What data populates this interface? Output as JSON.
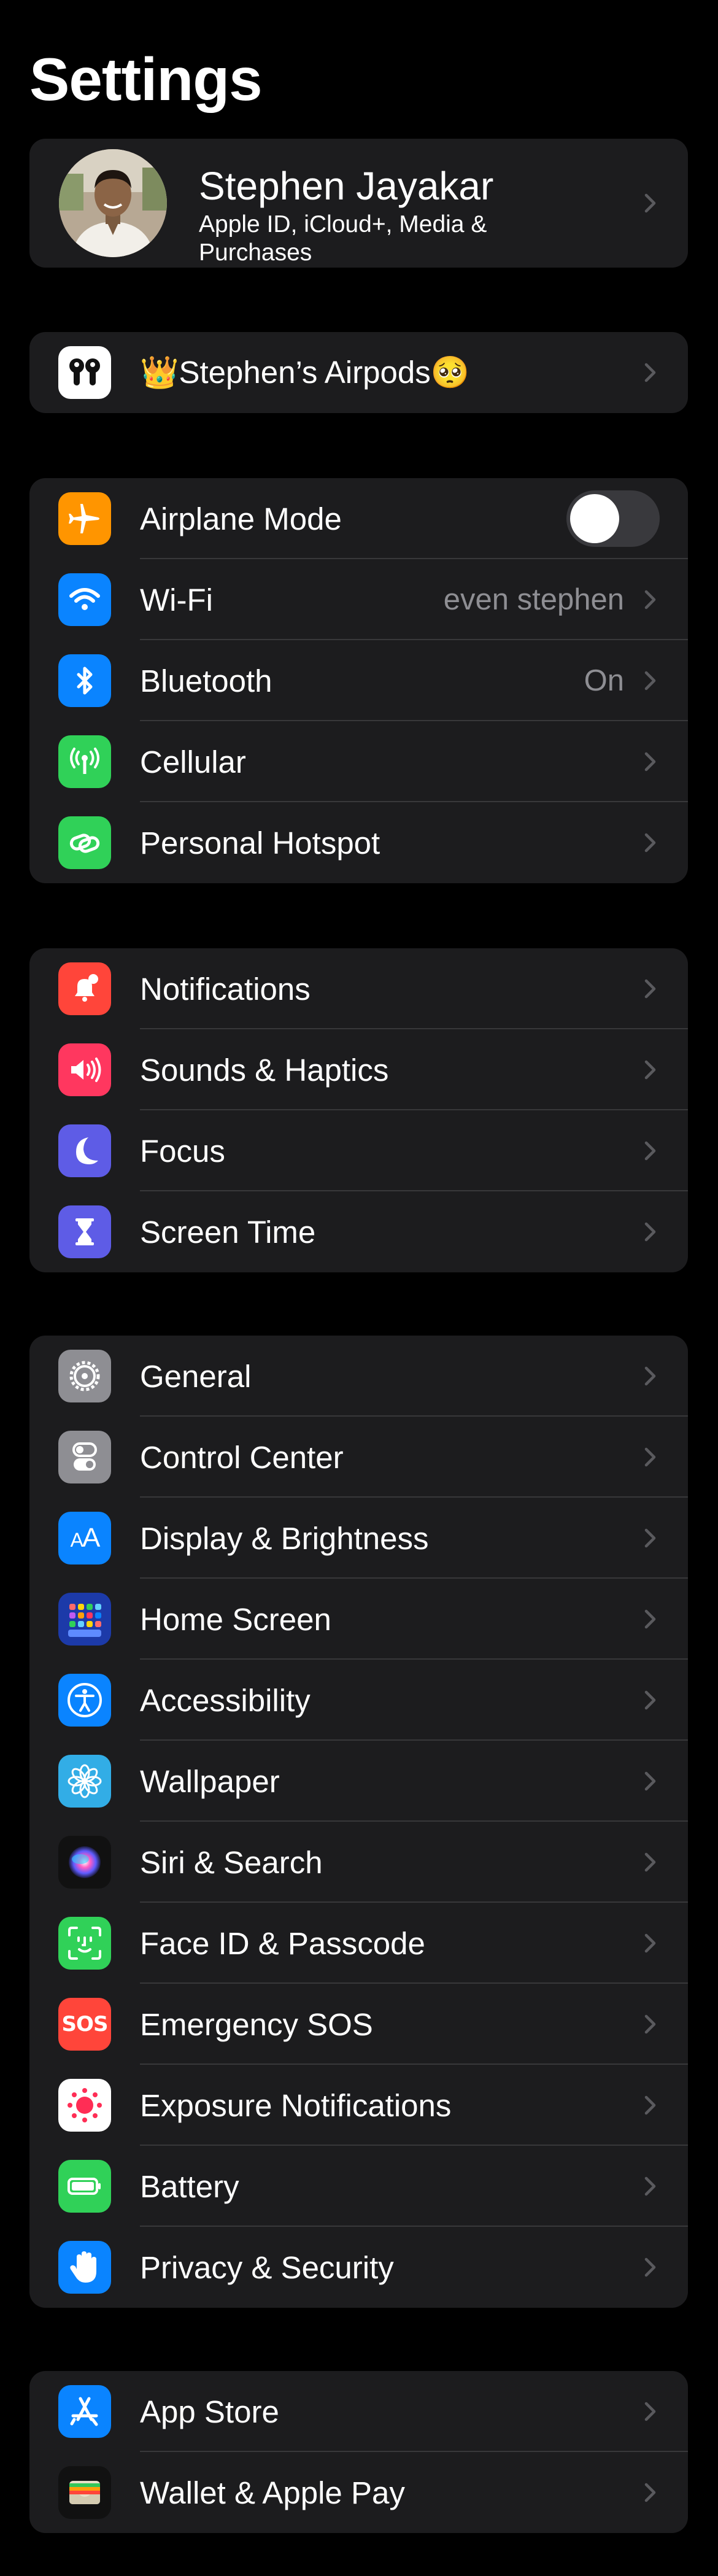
{
  "page": {
    "title": "Settings"
  },
  "profile": {
    "name": "Stephen Jayakar",
    "subtitle": "Apple ID, iCloud+, Media & Purchases"
  },
  "airpods": {
    "label": "👑Stephen’s Airpods🥺"
  },
  "connectivity": {
    "airplane_mode": {
      "label": "Airplane Mode",
      "on": false
    },
    "wifi": {
      "label": "Wi-Fi",
      "value": "even stephen"
    },
    "bluetooth": {
      "label": "Bluetooth",
      "value": "On"
    },
    "cellular": {
      "label": "Cellular"
    },
    "hotspot": {
      "label": "Personal Hotspot"
    }
  },
  "attention": {
    "notifications": {
      "label": "Notifications"
    },
    "sounds": {
      "label": "Sounds & Haptics"
    },
    "focus": {
      "label": "Focus"
    },
    "screen_time": {
      "label": "Screen Time"
    }
  },
  "system": {
    "general": {
      "label": "General"
    },
    "control_center": {
      "label": "Control Center"
    },
    "display": {
      "label": "Display & Brightness"
    },
    "home_screen": {
      "label": "Home Screen"
    },
    "accessibility": {
      "label": "Accessibility"
    },
    "wallpaper": {
      "label": "Wallpaper"
    },
    "siri": {
      "label": "Siri & Search"
    },
    "face_id": {
      "label": "Face ID & Passcode"
    },
    "sos": {
      "label": "Emergency SOS",
      "icon_text": "SOS"
    },
    "exposure": {
      "label": "Exposure Notifications"
    },
    "battery": {
      "label": "Battery"
    },
    "privacy": {
      "label": "Privacy & Security"
    }
  },
  "store": {
    "app_store": {
      "label": "App Store"
    },
    "wallet": {
      "label": "Wallet & Apple Pay"
    }
  },
  "colors": {
    "orange": "#ff9500",
    "blue": "#0a84ff",
    "green": "#30d158",
    "red": "#ff453a",
    "pink": "#ff375f",
    "indigo": "#5e5ce6",
    "gray": "#8e8e93",
    "teal": "#32ade6"
  }
}
